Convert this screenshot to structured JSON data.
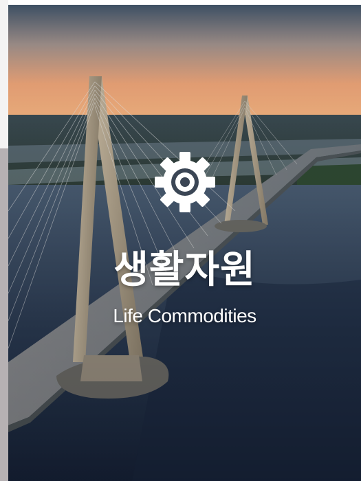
{
  "card": {
    "icon": "gear-icon",
    "title_ko": "생활자원",
    "title_en": "Life Commodities",
    "background": "cable-stayed bridge aerial photo at dusk"
  },
  "colors": {
    "text": "#ffffff",
    "sky_top": "#35495f",
    "sky_horizon": "#f0a36a",
    "water": "#1f2e44"
  }
}
